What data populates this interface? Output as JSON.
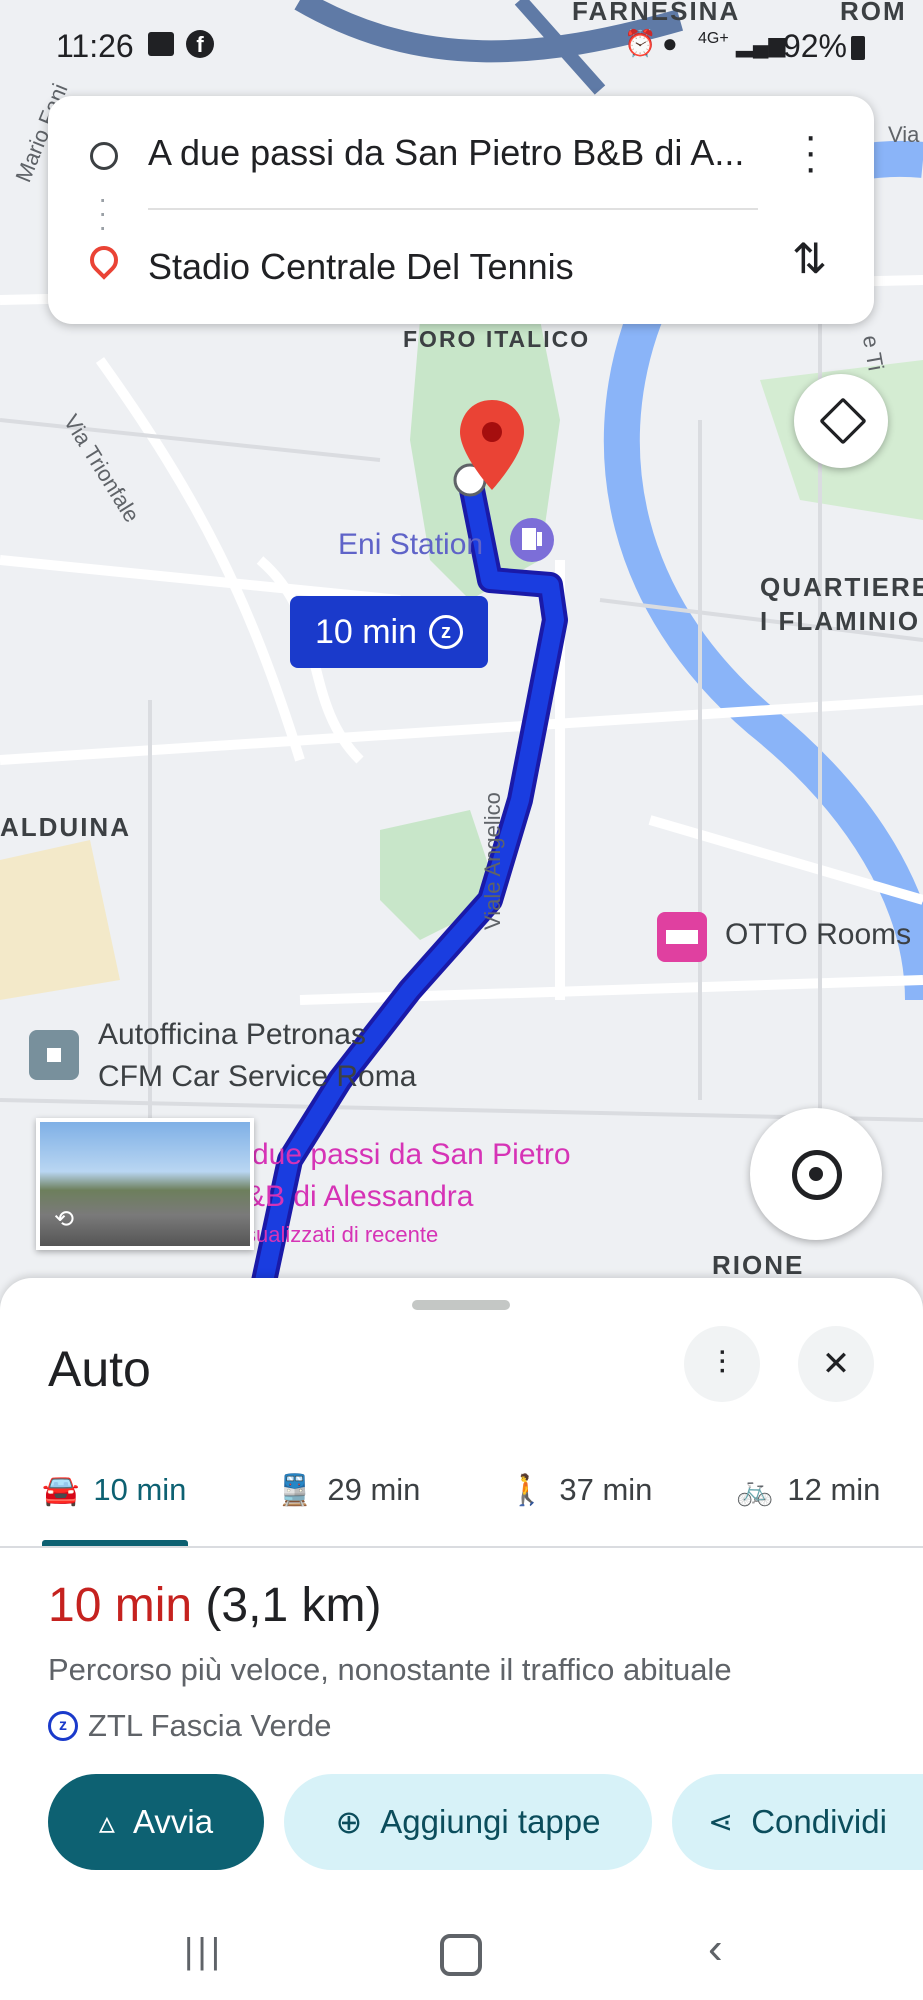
{
  "status_bar": {
    "time": "11:26",
    "network": "4G+",
    "battery": "92%"
  },
  "directions": {
    "origin": "A due passi da San Pietro B&B di A...",
    "destination": "Stadio Centrale Del Tennis"
  },
  "map": {
    "labels": {
      "farnesina": "FARNESINA",
      "roma": "ROM",
      "mario_fani": "Mario Fani",
      "via_top": "Via",
      "foro_italico": "FORO ITALICO",
      "via_trionfale": "Via Trionfale",
      "eni_station": "Eni Station",
      "quartiere_1": "QUARTIERE",
      "quartiere_2": "I FLAMINIO",
      "balduina": "ALDUINA",
      "viale_angelico": "Viale Angelico",
      "otto_rooms": "OTTO Rooms",
      "autofficina_1": "Autofficina Petronas",
      "autofficina_2": "CFM Car Service Roma",
      "bb_1": "due passi da San Pietro",
      "bb_2": "&B di Alessandra",
      "bb_3": "sualizzati di recente",
      "rione": "RIONE",
      "tiber_label": "e Ti"
    },
    "route_badge": "10 min",
    "route_color": "#1a3de0"
  },
  "sheet": {
    "title": "Auto",
    "tabs": [
      {
        "label": "10 min",
        "icon": "car-icon"
      },
      {
        "label": "29 min",
        "icon": "train-icon"
      },
      {
        "label": "37 min",
        "icon": "walk-icon"
      },
      {
        "label": "12 min",
        "icon": "bike-icon"
      }
    ],
    "duration": "10 min",
    "distance": "(3,1 km)",
    "description": "Percorso più veloce, nonostante il traffico abituale",
    "ztl": "ZTL Fascia Verde",
    "buttons": {
      "start": "Avvia",
      "add_stops": "Aggiungi tappe",
      "share": "Condividi"
    }
  },
  "colors": {
    "accent": "#0d6172",
    "duration": "#c5221f",
    "pill_bg": "#d7f2f8",
    "route": "#1a3de0"
  }
}
